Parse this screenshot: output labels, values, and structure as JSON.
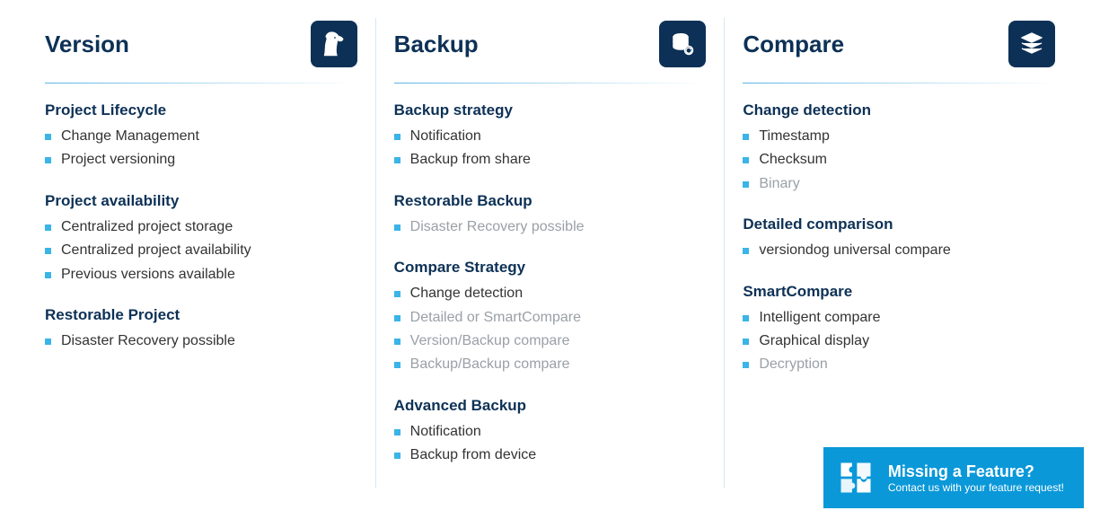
{
  "columns": [
    {
      "title": "Version",
      "icon": "dog-icon",
      "groups": [
        {
          "title": "Project Lifecycle",
          "items": [
            {
              "label": "Change Management"
            },
            {
              "label": "Project versioning"
            }
          ]
        },
        {
          "title": "Project availability",
          "items": [
            {
              "label": "Centralized project storage"
            },
            {
              "label": "Centralized project availability"
            },
            {
              "label": "Previous versions available"
            }
          ]
        },
        {
          "title": "Restorable Project",
          "items": [
            {
              "label": "Disaster Recovery possible"
            }
          ]
        }
      ]
    },
    {
      "title": "Backup",
      "icon": "database-restore-icon",
      "groups": [
        {
          "title": "Backup strategy",
          "items": [
            {
              "label": "Notification"
            },
            {
              "label": "Backup from share"
            }
          ]
        },
        {
          "title": "Restorable Backup",
          "items": [
            {
              "label": "Disaster Recovery possible",
              "dim": true
            }
          ]
        },
        {
          "title": "Compare Strategy",
          "items": [
            {
              "label": "Change detection"
            },
            {
              "label": "Detailed or SmartCompare",
              "dim": true
            },
            {
              "label": "Version/Backup compare",
              "dim": true
            },
            {
              "label": "Backup/Backup compare",
              "dim": true
            }
          ]
        },
        {
          "title": "Advanced Backup",
          "items": [
            {
              "label": "Notification"
            },
            {
              "label": "Backup from device"
            }
          ]
        }
      ]
    },
    {
      "title": "Compare",
      "icon": "layers-icon",
      "groups": [
        {
          "title": "Change detection",
          "items": [
            {
              "label": "Timestamp"
            },
            {
              "label": "Checksum"
            },
            {
              "label": "Binary",
              "dim": true
            }
          ]
        },
        {
          "title": "Detailed comparison",
          "items": [
            {
              "label": "versiondog universal compare"
            }
          ]
        },
        {
          "title": "SmartCompare",
          "items": [
            {
              "label": "Intelligent compare"
            },
            {
              "label": "Graphical display"
            },
            {
              "label": "Decryption",
              "dim": true
            }
          ]
        }
      ]
    }
  ],
  "cta": {
    "title": "Missing a Feature?",
    "subtitle": "Contact us with your feature request!"
  }
}
